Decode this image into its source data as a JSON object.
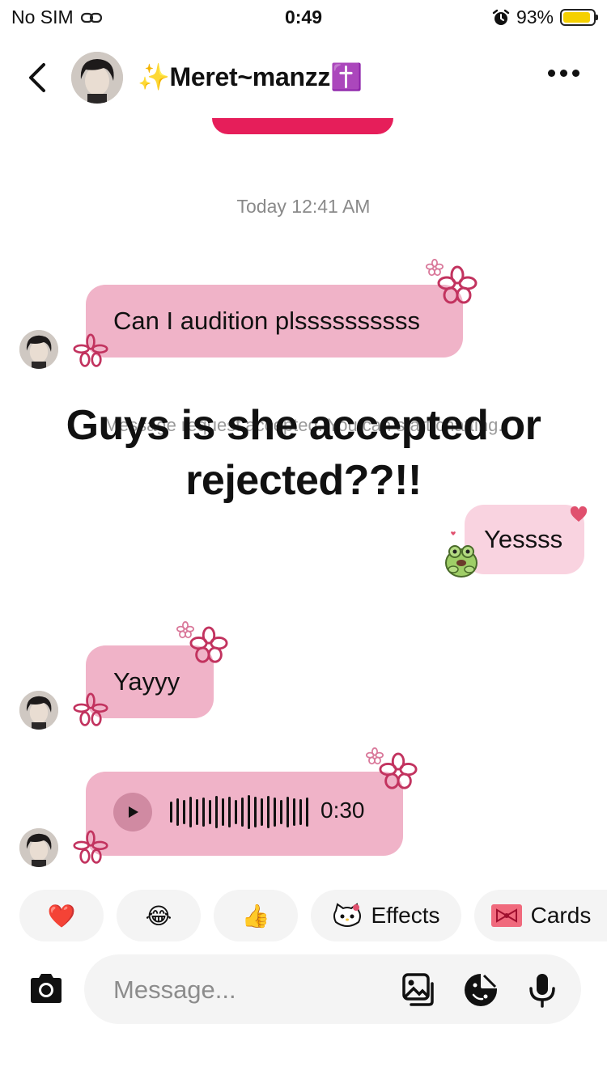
{
  "status_bar": {
    "carrier": "No SIM",
    "time": "0:49",
    "battery": "93%",
    "battery_level": 0.93,
    "battery_color": "#f5d000"
  },
  "header": {
    "contact_name": "✨Meret~manzz✝️",
    "back_icon": "chevron-left-icon",
    "more_icon": "ellipsis-icon"
  },
  "chat": {
    "timestamp": "Today 12:41 AM",
    "messages": [
      {
        "direction": "incoming",
        "text": "Can I audition plssssssssss"
      },
      {
        "direction": "outgoing",
        "text": "Yessss"
      },
      {
        "direction": "incoming",
        "text": "Yayyy"
      },
      {
        "direction": "incoming",
        "type": "voice",
        "duration": "0:30"
      }
    ],
    "system_note": "Message request accepted. You can start chatting.",
    "overlay_caption": "Guys is she accepted or rejected??!!"
  },
  "quick_actions": {
    "items": [
      {
        "icon": "heart-icon",
        "glyph": "❤️"
      },
      {
        "icon": "laughing-emoji-icon",
        "glyph": "😂"
      },
      {
        "icon": "thumbs-up-icon",
        "glyph": "👍"
      }
    ],
    "effects_label": "Effects",
    "cards_label": "Cards"
  },
  "composer": {
    "placeholder": "Message..."
  },
  "colors": {
    "incoming_bubble": "#f0b3c8",
    "outgoing_bubble": "#f9d3e0",
    "accent_bar": "#e61e5a",
    "flower": "#c2335f"
  }
}
